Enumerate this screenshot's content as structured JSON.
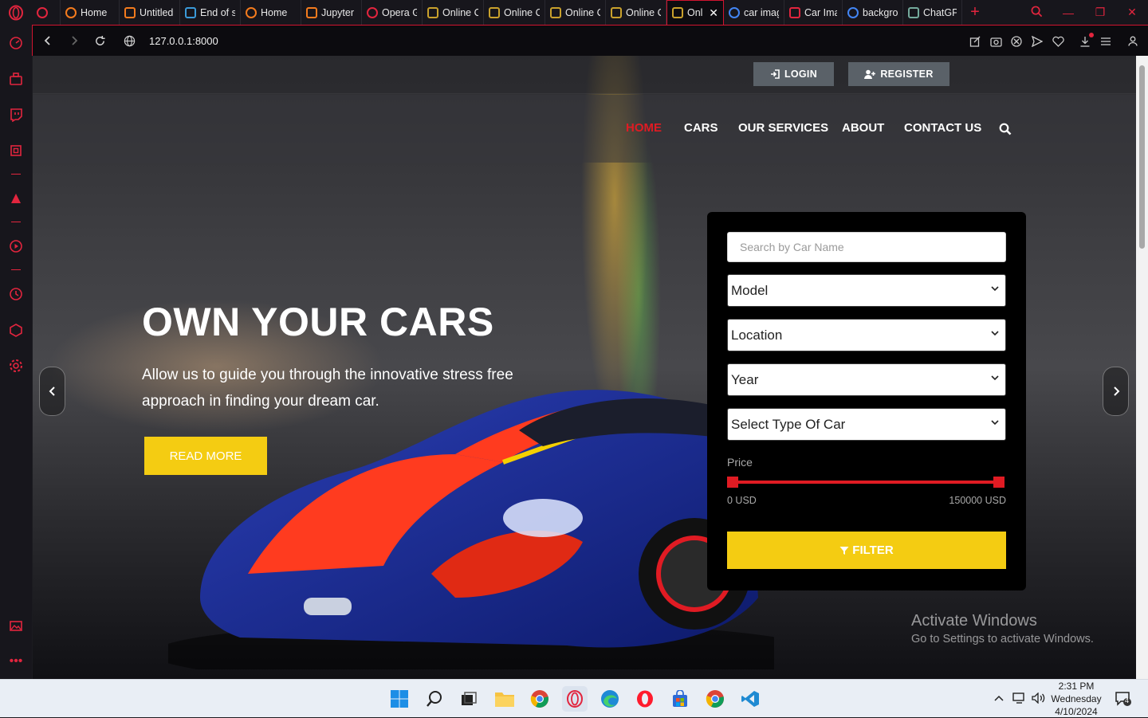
{
  "browser": {
    "tabs": [
      {
        "title": "",
        "favicon": "opera-gx-icon",
        "fav_color": "#e2253e"
      },
      {
        "title": "Home",
        "favicon": "opera-home-icon",
        "fav_color": "#f47b1d"
      },
      {
        "title": "Untitled",
        "favicon": "notebook-icon",
        "fav_color": "#f47b1d"
      },
      {
        "title": "End of s",
        "favicon": "microsoft-icon",
        "fav_color": "#3a9ad9"
      },
      {
        "title": "Home",
        "favicon": "opera-home-icon",
        "fav_color": "#f47b1d"
      },
      {
        "title": "Jupyter",
        "favicon": "notebook-icon",
        "fav_color": "#f47b1d"
      },
      {
        "title": "Opera G",
        "favicon": "opera-icon",
        "fav_color": "#e2253e"
      },
      {
        "title": "Online C",
        "favicon": "crown-icon",
        "fav_color": "#c9a12c"
      },
      {
        "title": "Online C",
        "favicon": "crown-icon",
        "fav_color": "#c9a12c"
      },
      {
        "title": "Online C",
        "favicon": "crown-icon",
        "fav_color": "#c9a12c"
      },
      {
        "title": "Online C",
        "favicon": "crown-icon",
        "fav_color": "#c9a12c"
      },
      {
        "title": "Onli",
        "favicon": "crown-icon",
        "fav_color": "#c9a12c",
        "active": true
      },
      {
        "title": "car imag",
        "favicon": "google-icon",
        "fav_color": "#4285f4"
      },
      {
        "title": "Car Ima",
        "favicon": "car-site-icon",
        "fav_color": "#e2253e"
      },
      {
        "title": "backgro",
        "favicon": "google-icon",
        "fav_color": "#4285f4"
      },
      {
        "title": "ChatGPT",
        "favicon": "chatgpt-icon",
        "fav_color": "#74aa9c"
      }
    ],
    "url": "127.0.0.1:8000",
    "accent": "#e2253e"
  },
  "site": {
    "login_label": "LOGIN",
    "register_label": "REGISTER",
    "menu": [
      "HOME",
      "CARS",
      "OUR SERVICES",
      "ABOUT",
      "CONTACT US"
    ],
    "menu_active": "HOME",
    "hero_title": "OWN YOUR CARS",
    "hero_subtitle": "Allow us to guide you through the innovative stress free approach in finding your dream car.",
    "read_more_label": "READ MORE",
    "accent_yellow": "#f4cc12",
    "accent_red": "#e01b23"
  },
  "filter": {
    "search_placeholder": "Search by Car Name",
    "model_value": "Model",
    "location_value": "Location",
    "year_value": "Year",
    "type_value": "Select Type Of Car",
    "price_label": "Price",
    "price_min": "0 USD",
    "price_max": "150000 USD",
    "filter_label": "FILTER"
  },
  "watermark": {
    "title": "Activate Windows",
    "subtitle": "Go to Settings to activate Windows."
  },
  "taskbar": {
    "time": "2:31 PM",
    "day": "Wednesday",
    "date": "4/10/2024",
    "notifications": "4"
  }
}
